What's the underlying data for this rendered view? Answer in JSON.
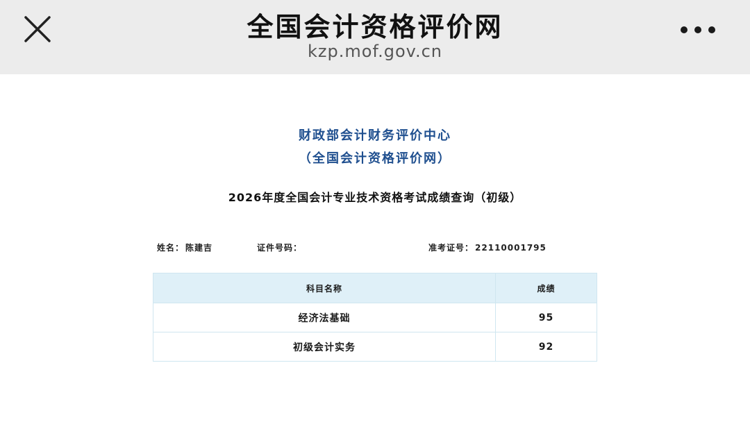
{
  "browser_bar": {
    "title": "全国会计资格评价网",
    "url": "kzp.mof.gov.cn",
    "close_icon": "close-icon",
    "more_icon": "more-dots-icon"
  },
  "header": {
    "org_name": "财政部会计财务评价中心",
    "org_sub": "（全国会计资格评价网）",
    "page_title": "2026年度全国会计专业技术资格考试成绩查询（初级）"
  },
  "candidate": {
    "name_label": "姓名：",
    "name_value": "陈建吉",
    "id_label": "证件号码：",
    "id_value": "",
    "ticket_label": "准考证号：",
    "ticket_value": "22110001795"
  },
  "table": {
    "headers": [
      "科目名称",
      "成绩"
    ],
    "rows": [
      {
        "subject": "经济法基础",
        "score": "95"
      },
      {
        "subject": "初级会计实务",
        "score": "92"
      }
    ]
  },
  "colors": {
    "bar_bg": "#ececec",
    "org_text": "#1f4f8f",
    "table_header_bg": "#dff0f8",
    "table_border": "#cfe6f0"
  }
}
